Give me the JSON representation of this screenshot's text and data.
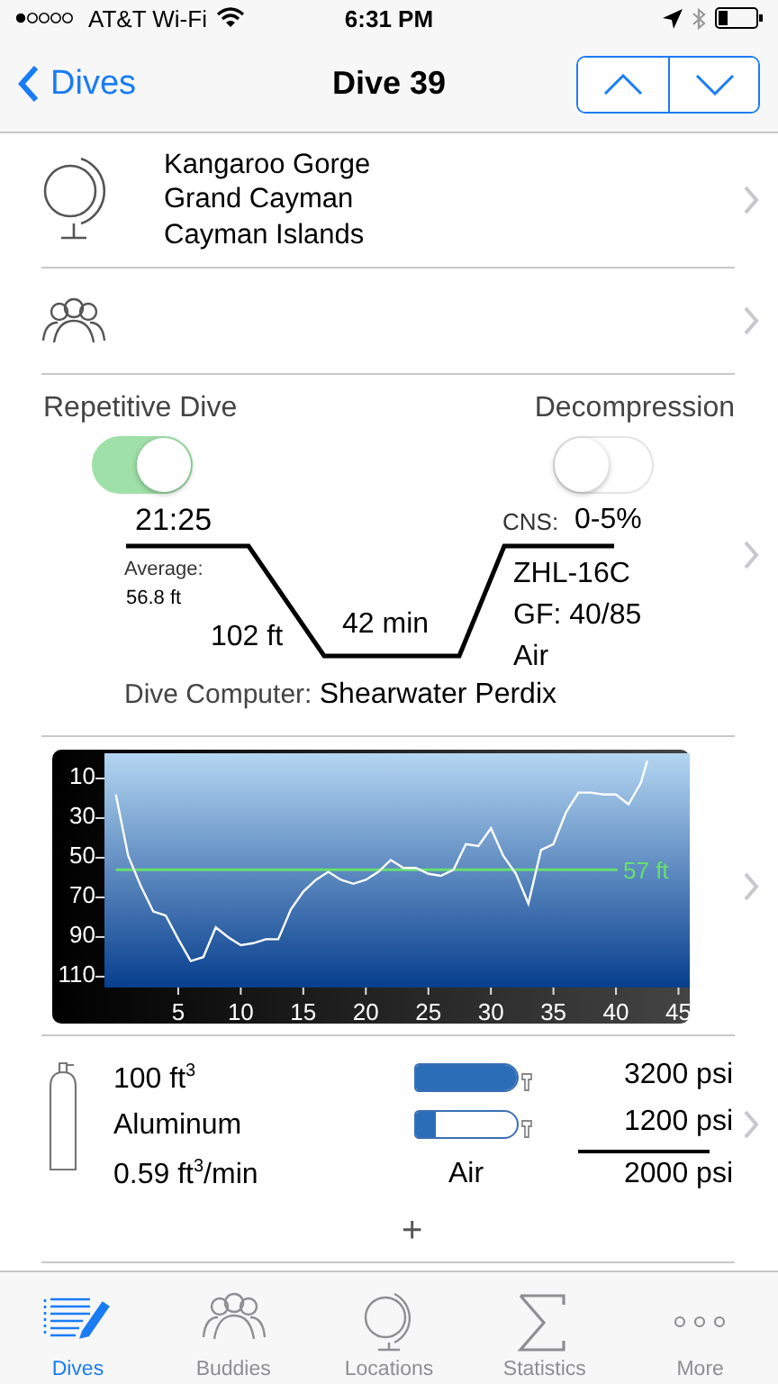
{
  "status_bar": {
    "carrier": "AT&T Wi-Fi",
    "time": "6:31 PM"
  },
  "nav": {
    "back": "Dives",
    "title": "Dive 39"
  },
  "location": {
    "lines": [
      "Kangaroo Gorge",
      "Grand Cayman",
      "Cayman Islands"
    ]
  },
  "profile": {
    "repetitive": {
      "label": "Repetitive Dive",
      "on": true
    },
    "decompression": {
      "label": "Decompression",
      "on": false
    },
    "entry_time": "21:25",
    "average_label": "Average:",
    "average": "56.8 ft",
    "max_depth": "102 ft",
    "duration": "42 min",
    "cns_label": "CNS:",
    "cns": "0-5%",
    "algorithm": "ZHL-16C",
    "gf": "GF: 40/85",
    "gas": "Air",
    "computer_label": "Dive Computer:",
    "computer": "Shearwater Perdix"
  },
  "chart_data": {
    "type": "line",
    "x": [
      0,
      1,
      2,
      3,
      4,
      5,
      6,
      7,
      8,
      9,
      10,
      11,
      12,
      13,
      14,
      15,
      16,
      17,
      18,
      19,
      20,
      21,
      22,
      23,
      24,
      25,
      26,
      27,
      28,
      29,
      30,
      31,
      32,
      33,
      34,
      35,
      36,
      37,
      38,
      39,
      40,
      41,
      42,
      42.5
    ],
    "series": [
      {
        "color": "#ffffff",
        "values": [
          19,
          50,
          65,
          78,
          80,
          92,
          103,
          101,
          86,
          91,
          95,
          94,
          92,
          92,
          77,
          68,
          62,
          58,
          62,
          64,
          62,
          58,
          52,
          56,
          56,
          59,
          60,
          57,
          44,
          45,
          36,
          50,
          59,
          74,
          47,
          44,
          28,
          18,
          18,
          19,
          19,
          24,
          13,
          2
        ]
      }
    ],
    "xlim": [
      -0.9,
      45.9
    ],
    "ylim": [
      116.4,
      -1.8
    ],
    "xticks": [
      5,
      10,
      15,
      20,
      25,
      30,
      35,
      40,
      45
    ],
    "yticks": [
      10,
      30,
      50,
      70,
      90,
      110
    ],
    "ref_lines": [
      {
        "axis": "y",
        "value": 57,
        "label": "57 ft",
        "color": "#66e070"
      }
    ]
  },
  "tanks": [
    {
      "size": "100 ft$^{3}$",
      "material": "Aluminum",
      "sac": "0.59 ft$^{3}$/min",
      "start": {
        "level": 1.0,
        "reading": "3200 psi"
      },
      "end": {
        "level": 0.2,
        "reading": "1200 psi"
      },
      "gas": "Air",
      "used": "2000 psi"
    }
  ],
  "add_label": "+",
  "tabs": [
    {
      "label": "Dives",
      "kind": "dives",
      "selected": true
    },
    {
      "label": "Buddies",
      "kind": "buddies",
      "selected": false
    },
    {
      "label": "Locations",
      "kind": "locations",
      "selected": false
    },
    {
      "label": "Statistics",
      "kind": "statistics",
      "selected": false
    },
    {
      "label": "More",
      "kind": "more",
      "selected": false
    }
  ]
}
